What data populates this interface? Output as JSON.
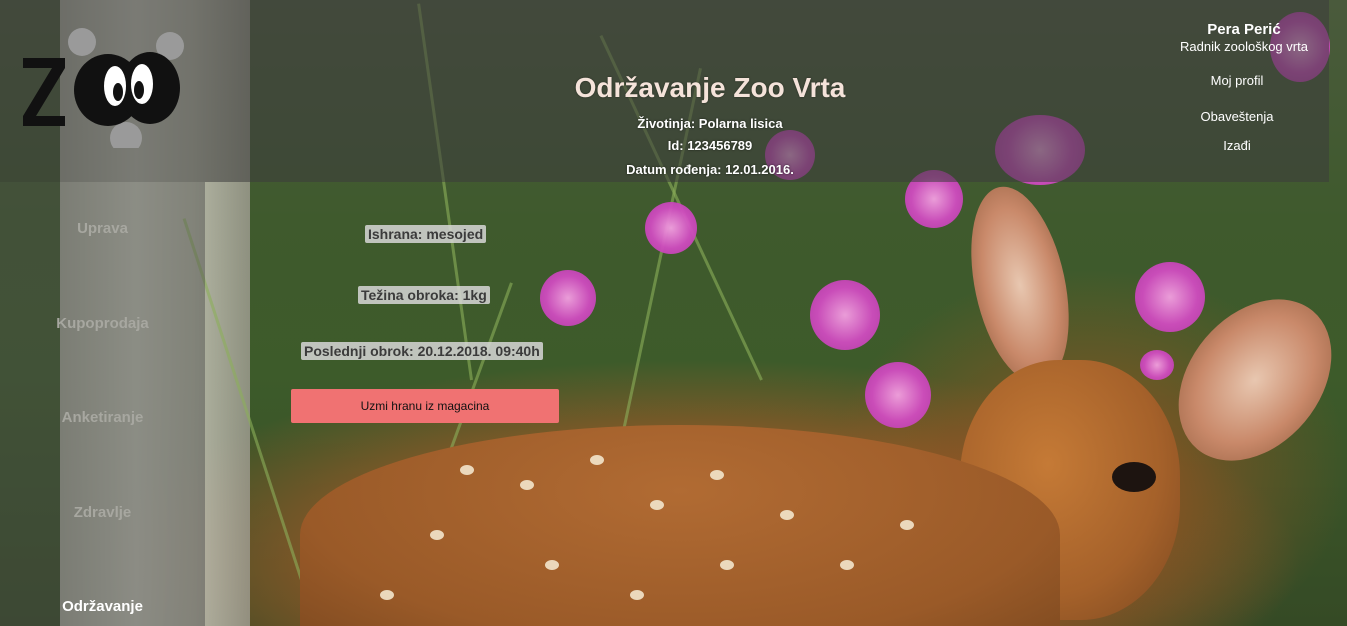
{
  "logo": {
    "text": "ZOO"
  },
  "header": {
    "title": "Održavanje Zoo Vrta",
    "animal_line": "Životinja: Polarna lisica",
    "id_line": "Id: 123456789",
    "birth_line": "Datum rođenja: 12.01.2016."
  },
  "user": {
    "name": "Pera Perić",
    "role": "Radnik zoološkog vrta",
    "links": [
      "Moj profil",
      "Obaveštenja",
      "Izađi"
    ]
  },
  "sidebar": {
    "items": [
      {
        "label": "Uprava",
        "active": false
      },
      {
        "label": "Kupoprodaja",
        "active": false
      },
      {
        "label": "Anketiranje",
        "active": false
      },
      {
        "label": "Zdravlje",
        "active": false
      },
      {
        "label": "Održavanje",
        "active": true
      }
    ]
  },
  "content": {
    "diet": "Ishrana: mesojed",
    "meal_weight": "Težina obroka: 1kg",
    "last_meal": "Poslednji obrok: 20.12.2018. 09:40h",
    "action_button": "Uzmi hranu iz magacina"
  },
  "colors": {
    "button_bg": "#f07272",
    "title_color": "#f5e3da"
  }
}
